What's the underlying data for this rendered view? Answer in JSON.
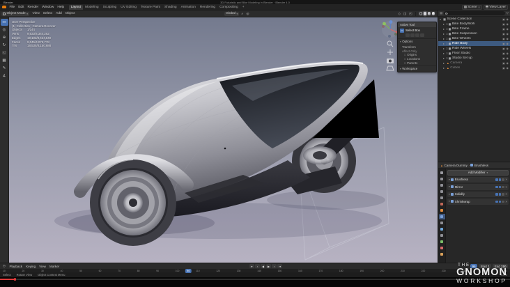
{
  "window": {
    "app_label": "Blender",
    "title": "3D Futuristic and Bike Modeling in Blender  ·  Blender 4.0"
  },
  "menu_bar": {
    "menus": [
      "File",
      "Edit",
      "Render",
      "Window",
      "Help"
    ],
    "workspaces": [
      {
        "label": "Layout",
        "active": true
      },
      {
        "label": "Modeling"
      },
      {
        "label": "Sculpting"
      },
      {
        "label": "UV Editing"
      },
      {
        "label": "Texture Paint"
      },
      {
        "label": "Shading"
      },
      {
        "label": "Animation"
      },
      {
        "label": "Rendering"
      },
      {
        "label": "Compositing"
      },
      {
        "label": "+"
      }
    ],
    "scene_label": "Scene",
    "view_layer_label": "View Layer"
  },
  "viewport_header": {
    "mode": "Object Mode",
    "menus": [
      "View",
      "Select",
      "Add",
      "Object"
    ],
    "orientation": "Global",
    "shading_modes": [
      {
        "name": "wireframe-shading-button"
      },
      {
        "name": "solid-shading-button",
        "active": true
      },
      {
        "name": "material-shading-button"
      },
      {
        "name": "rendered-shading-button"
      }
    ]
  },
  "toolbar": [
    {
      "name": "select-box-tool",
      "glyph": "▭",
      "active": true
    },
    {
      "name": "cursor-tool",
      "glyph": "◎"
    },
    {
      "name": "move-tool",
      "glyph": "⊕"
    },
    {
      "name": "rotate-tool",
      "glyph": "↻"
    },
    {
      "name": "scale-tool",
      "glyph": "◱"
    },
    {
      "name": "transform-tool",
      "glyph": "▦"
    },
    {
      "name": "annotate-tool",
      "glyph": "✎"
    },
    {
      "name": "measure-tool",
      "glyph": "∡"
    }
  ],
  "viewport_stats": {
    "view": "User Perspective",
    "context": "(1) Collection | Camera.Recover",
    "rows": [
      {
        "label": "Objects",
        "value": "1/144"
      },
      {
        "label": "Verts",
        "value": "9,633/4,344,262"
      },
      {
        "label": "Edges",
        "value": "19,102/8,424,540"
      },
      {
        "label": "Faces",
        "value": "9,045/4,079,778"
      },
      {
        "label": "Tris",
        "value": "18,534/8,150,688"
      }
    ]
  },
  "tool_popover": {
    "title": "Active Tool",
    "tool_name": "Select Box",
    "options_label": "Options",
    "transform_label": "Transform",
    "affect_label": "Affect Only",
    "checkboxes": [
      {
        "label": "Origins"
      },
      {
        "label": "Locations"
      },
      {
        "label": "Parents"
      }
    ],
    "workspace_label": "Workspace"
  },
  "outliner": {
    "rows": [
      {
        "disc": "▾",
        "chk": "",
        "icon": "▦",
        "label": "Scene Collection",
        "type": "collection",
        "indent": 0
      },
      {
        "disc": "▸",
        "chk": "□",
        "icon": "▦",
        "label": "Bike BodyWork",
        "type": "collection",
        "indent": 1
      },
      {
        "disc": "▸",
        "chk": "□",
        "icon": "▦",
        "label": "Bike Frame",
        "type": "collection",
        "indent": 1
      },
      {
        "disc": "▸",
        "chk": "□",
        "icon": "▦",
        "label": "Bike Suspension",
        "type": "collection",
        "indent": 1
      },
      {
        "disc": "▸",
        "chk": "□",
        "icon": "▦",
        "label": "Bike Wheels",
        "type": "collection",
        "indent": 1
      },
      {
        "disc": "▸",
        "chk": "□",
        "icon": "▦",
        "label": "Ride Body",
        "type": "collection",
        "indent": 1,
        "active": true
      },
      {
        "disc": "▸",
        "chk": "□",
        "icon": "▦",
        "label": "Ride Wheels",
        "type": "collection",
        "indent": 1
      },
      {
        "disc": "▸",
        "chk": "□",
        "icon": "▦",
        "label": "Floor Studio",
        "type": "collection",
        "indent": 1
      },
      {
        "disc": "▸",
        "chk": "□",
        "icon": "▦",
        "label": "Studio Set up",
        "type": "collection",
        "indent": 1
      },
      {
        "disc": "▸",
        "chk": "",
        "icon": "▲",
        "label": "Camera",
        "type": "object",
        "indent": 1,
        "muted": true
      },
      {
        "disc": "▸",
        "chk": "",
        "icon": "▲",
        "label": "Cubes",
        "type": "object",
        "indent": 1,
        "muted": true
      }
    ]
  },
  "properties": {
    "breadcrumb_object": "Camera Dummy",
    "breadcrumb_item": "Brushless",
    "add_modifier_label": "Add Modifier",
    "modifiers": [
      {
        "name": "Brushless"
      },
      {
        "name": "Mirror"
      },
      {
        "name": "Solidify"
      },
      {
        "name": "Shrinkwrap"
      }
    ],
    "tabs": [
      {
        "name": "tool-tab",
        "color": "#9a9aa0"
      },
      {
        "name": "render-tab",
        "color": "#8f8f95"
      },
      {
        "name": "output-tab",
        "color": "#8f8f95"
      },
      {
        "name": "view-layer-tab",
        "color": "#8f8f95"
      },
      {
        "name": "scene-tab",
        "color": "#8f8f95"
      },
      {
        "name": "world-tab",
        "color": "#c06858"
      },
      {
        "name": "object-tab",
        "color": "#e08a3c"
      },
      {
        "name": "modifiers-tab",
        "color": "#7aa0d8",
        "active": true
      },
      {
        "name": "particles-tab",
        "color": "#8f8f95"
      },
      {
        "name": "physics-tab",
        "color": "#6fa8dc"
      },
      {
        "name": "constraints-tab",
        "color": "#8f8f95"
      },
      {
        "name": "data-tab",
        "color": "#7bbf6a"
      },
      {
        "name": "material-tab",
        "color": "#d86a6a"
      },
      {
        "name": "texture-tab",
        "color": "#d8a05a"
      }
    ]
  },
  "timeline": {
    "menus": [
      "Playback",
      "Keying",
      "View",
      "Marker"
    ],
    "controls": [
      {
        "name": "jump-to-start-button",
        "glyph": "⇤"
      },
      {
        "name": "previous-keyframe-button",
        "glyph": "‹"
      },
      {
        "name": "play-reverse-button",
        "glyph": "◀"
      },
      {
        "name": "play-button",
        "glyph": "▶"
      },
      {
        "name": "next-keyframe-button",
        "glyph": "›"
      },
      {
        "name": "jump-to-end-button",
        "glyph": "⇥"
      }
    ],
    "current_frame": "96",
    "start_label": "Start",
    "start_value": "1",
    "end_label": "End",
    "end_value": "250",
    "ruler_labels": [
      "10",
      "20",
      "30",
      "40",
      "50",
      "60",
      "70",
      "80",
      "90",
      "100",
      "110",
      "120",
      "130",
      "140",
      "150",
      "160",
      "170",
      "180",
      "190",
      "200",
      "210",
      "220",
      "230",
      "240",
      "250",
      "260"
    ]
  },
  "status_bar": {
    "items": [
      "Select",
      "Rotate View",
      "Object Context Menu"
    ],
    "version": "4.0.0"
  },
  "player": {
    "progress_percent": 3
  },
  "watermark": {
    "line1": "THE",
    "line2": "GNOMON",
    "line3": "WORKSHOP"
  },
  "icons": {
    "blender-logo-icon": "orange-rounded-square",
    "search-icon": "magnifier",
    "filter-icon": "▽",
    "disclosure-icon": "▸",
    "collection-icon": "▦",
    "object-icon": "▲",
    "hide-viewport-toggle-icon": "◉",
    "hide-render-toggle-icon": "▣",
    "close-icon": "×",
    "caret-icon": "▾",
    "snap-magnet-icon": "∩",
    "editor-clock-icon": "◷"
  }
}
